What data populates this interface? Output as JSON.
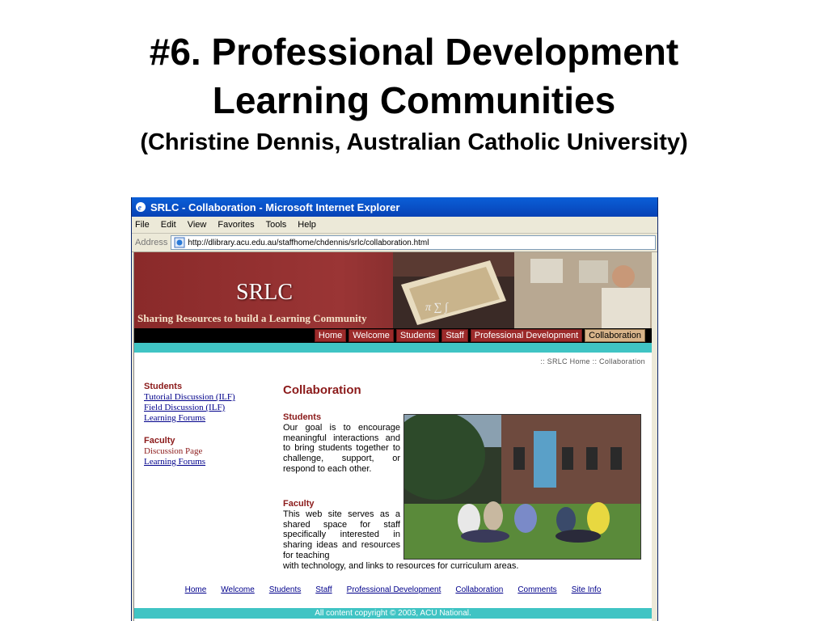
{
  "slide": {
    "title_line1": "#6. Professional Development",
    "title_line2": "Learning Communities",
    "subtitle": "(Christine Dennis, Australian Catholic University)"
  },
  "browser": {
    "window_title": "SRLC - Collaboration - Microsoft Internet Explorer",
    "menu": [
      "File",
      "Edit",
      "View",
      "Favorites",
      "Tools",
      "Help"
    ],
    "address_label": "Address",
    "url": "http://dlibrary.acu.edu.au/staffhome/chdennis/srlc/collaboration.html"
  },
  "site": {
    "logo": "SRLC",
    "tagline": "Sharing Resources to build a Learning Community",
    "nav": [
      "Home",
      "Welcome",
      "Students",
      "Staff",
      "Professional Development",
      "Collaboration"
    ],
    "active_nav": "Collaboration",
    "breadcrumb": ":: SRLC Home :: Collaboration",
    "sidebar": {
      "students_heading": "Students",
      "students_links": [
        "Tutorial Discussion (ILF)",
        "Field Discussion (ILF)",
        "Learning Forums"
      ],
      "faculty_heading": "Faculty",
      "faculty_text": "Discussion Page",
      "faculty_links": [
        "Learning Forums"
      ]
    },
    "page_title": "Collaboration",
    "students_heading": "Students",
    "students_body": "Our goal is to encourage meaningful interactions and to bring students together to challenge, support, or respond to each other.",
    "faculty_heading": "Faculty",
    "faculty_body": "This web site serves as a shared space for staff specifically interested in sharing ideas and resources for teaching",
    "faculty_tail": "with technology, and links to resources for curriculum areas.",
    "footer_links": [
      "Home",
      "Welcome",
      "Students",
      "Staff",
      "Professional Development",
      "Collaboration",
      "Comments",
      "Site Info"
    ],
    "copyright": "All content copyright © 2003, ACU National."
  },
  "colors": {
    "accent_red": "#8b1a1a",
    "teal": "#40c4c4",
    "ie_blue": "#0a5fd8"
  }
}
